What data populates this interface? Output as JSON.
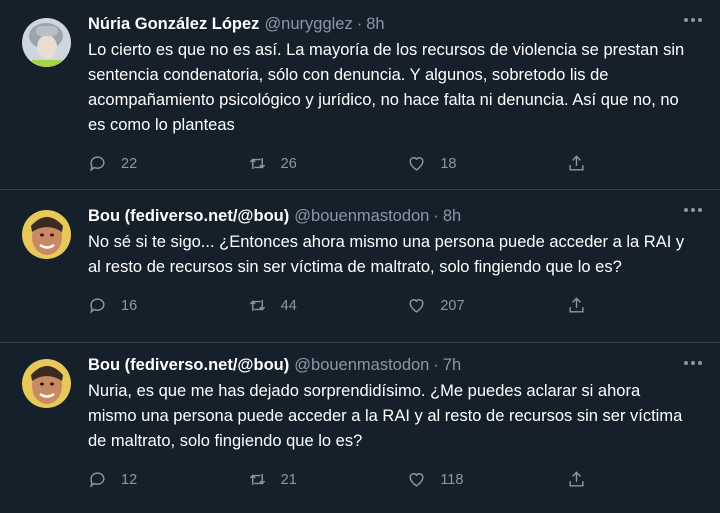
{
  "tweets": [
    {
      "name": "Núria González López",
      "handle": "@nurygglez",
      "separator": "·",
      "time": "8h",
      "text": "Lo cierto es que no es así. La mayoría de los recursos de violencia se prestan sin sentencia condenatoria, sólo con denuncia. Y algunos, sobretodo lis de acompañamiento psicológico y jurídico, no hace falta ni denuncia. Así que no, no es como lo planteas",
      "replies": "22",
      "retweets": "26",
      "likes": "18"
    },
    {
      "name": "Bou (fediverso.net/@bou)",
      "handle": "@bouenmastodon",
      "separator": "·",
      "time": "8h",
      "text": "No sé si te sigo... ¿Entonces ahora mismo una persona puede acceder a la RAI y al resto de recursos sin ser víctima de maltrato, solo fingiendo que lo es?",
      "replies": "16",
      "retweets": "44",
      "likes": "207"
    },
    {
      "name": "Bou (fediverso.net/@bou)",
      "handle": "@bouenmastodon",
      "separator": "·",
      "time": "7h",
      "text": "Nuria, es que me has dejado sorprendidísimo. ¿Me puedes aclarar si ahora mismo una persona puede acceder a la RAI y al resto de recursos sin ser víctima de maltrato, solo fingiendo que lo es?",
      "replies": "12",
      "retweets": "21",
      "likes": "118"
    }
  ],
  "colors": {
    "background": "#15202b",
    "text": "#ffffff",
    "muted": "#8899a6",
    "divider": "#38444d"
  },
  "icons": [
    "reply-icon",
    "retweet-icon",
    "like-icon",
    "share-icon",
    "more-icon"
  ]
}
